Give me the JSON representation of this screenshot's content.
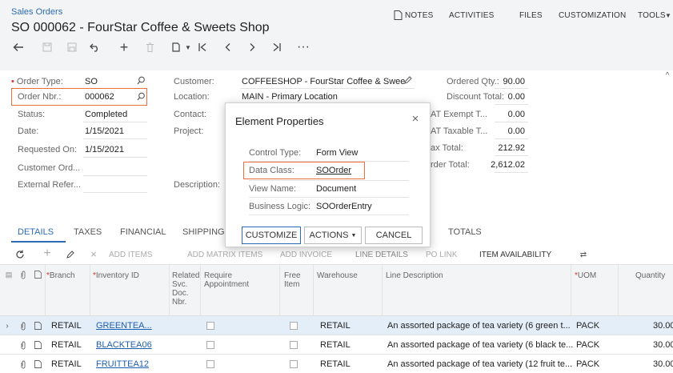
{
  "header": {
    "breadcrumb": "Sales Orders",
    "title": "SO 000062 - FourStar Coffee & Sweets Shop",
    "menu": [
      "NOTES",
      "ACTIVITIES",
      "FILES",
      "CUSTOMIZATION",
      "TOOLS"
    ]
  },
  "form": {
    "order_type_label": "Order Type:",
    "order_type": "SO",
    "order_nbr_label": "Order Nbr.:",
    "order_nbr": "000062",
    "status_label": "Status:",
    "status": "Completed",
    "date_label": "Date:",
    "date": "1/15/2021",
    "requested_on_label": "Requested On:",
    "requested_on": "1/15/2021",
    "customer_ord_label": "Customer Ord...",
    "external_refer_label": "External Refer...",
    "customer_label": "Customer:",
    "customer": "COFFEESHOP - FourStar Coffee & Swee",
    "location_label": "Location:",
    "location": "MAIN - Primary Location",
    "contact_label": "Contact:",
    "project_label": "Project:",
    "description_label": "Description:",
    "ordered_qty_label": "Ordered Qty.:",
    "ordered_qty": "90.00",
    "discount_total_label": "Discount Total:",
    "discount_total": "0.00",
    "vat_exempt_label": "AT Exempt T...",
    "vat_exempt": "0.00",
    "vat_taxable_label": "AT Taxable T...",
    "vat_taxable": "0.00",
    "tax_total_label": "ax Total:",
    "tax_total": "212.92",
    "order_total_label": "rder Total:",
    "order_total": "2,612.02"
  },
  "tabs": [
    "DETAILS",
    "TAXES",
    "FINANCIAL",
    "SHIPPING",
    "TOTALS"
  ],
  "grid_toolbar": {
    "add_items": "ADD ITEMS",
    "add_matrix": "ADD MATRIX ITEMS",
    "add_invoice": "ADD INVOICE",
    "line_details": "LINE DETAILS",
    "po_link": "PO LINK",
    "item_availability": "ITEM AVAILABILITY"
  },
  "grid": {
    "headers": {
      "branch": "Branch",
      "inventory_id": "Inventory ID",
      "related": "Related Svc. Doc. Nbr.",
      "require_appt": "Require Appointment",
      "free_item": "Free Item",
      "warehouse": "Warehouse",
      "line_desc": "Line Description",
      "uom": "UOM",
      "quantity": "Quantity"
    },
    "rows": [
      {
        "branch": "RETAIL",
        "inventory_id": "GREENTEA...",
        "warehouse": "RETAIL",
        "desc": "An assorted package of tea variety (6 green t...",
        "uom": "PACK",
        "qty": "30.00"
      },
      {
        "branch": "RETAIL",
        "inventory_id": "BLACKTEA06",
        "warehouse": "RETAIL",
        "desc": "An assorted package of tea variety (6 black te...",
        "uom": "PACK",
        "qty": "30.00"
      },
      {
        "branch": "RETAIL",
        "inventory_id": "FRUITTEA12",
        "warehouse": "RETAIL",
        "desc": "An assorted package of tea variety (12 fruit te...",
        "uom": "PACK",
        "qty": "30.00"
      }
    ]
  },
  "dialog": {
    "title": "Element Properties",
    "control_type_label": "Control Type:",
    "control_type": "Form View",
    "data_class_label": "Data Class:",
    "data_class": "SOOrder",
    "view_name_label": "View Name:",
    "view_name": "Document",
    "business_logic_label": "Business Logic:",
    "business_logic": "SOOrderEntry",
    "customize": "CUSTOMIZE",
    "actions": "ACTIONS",
    "cancel": "CANCEL"
  },
  "colors": {
    "accent": "#2d6bb4",
    "highlight": "#e9703a"
  }
}
